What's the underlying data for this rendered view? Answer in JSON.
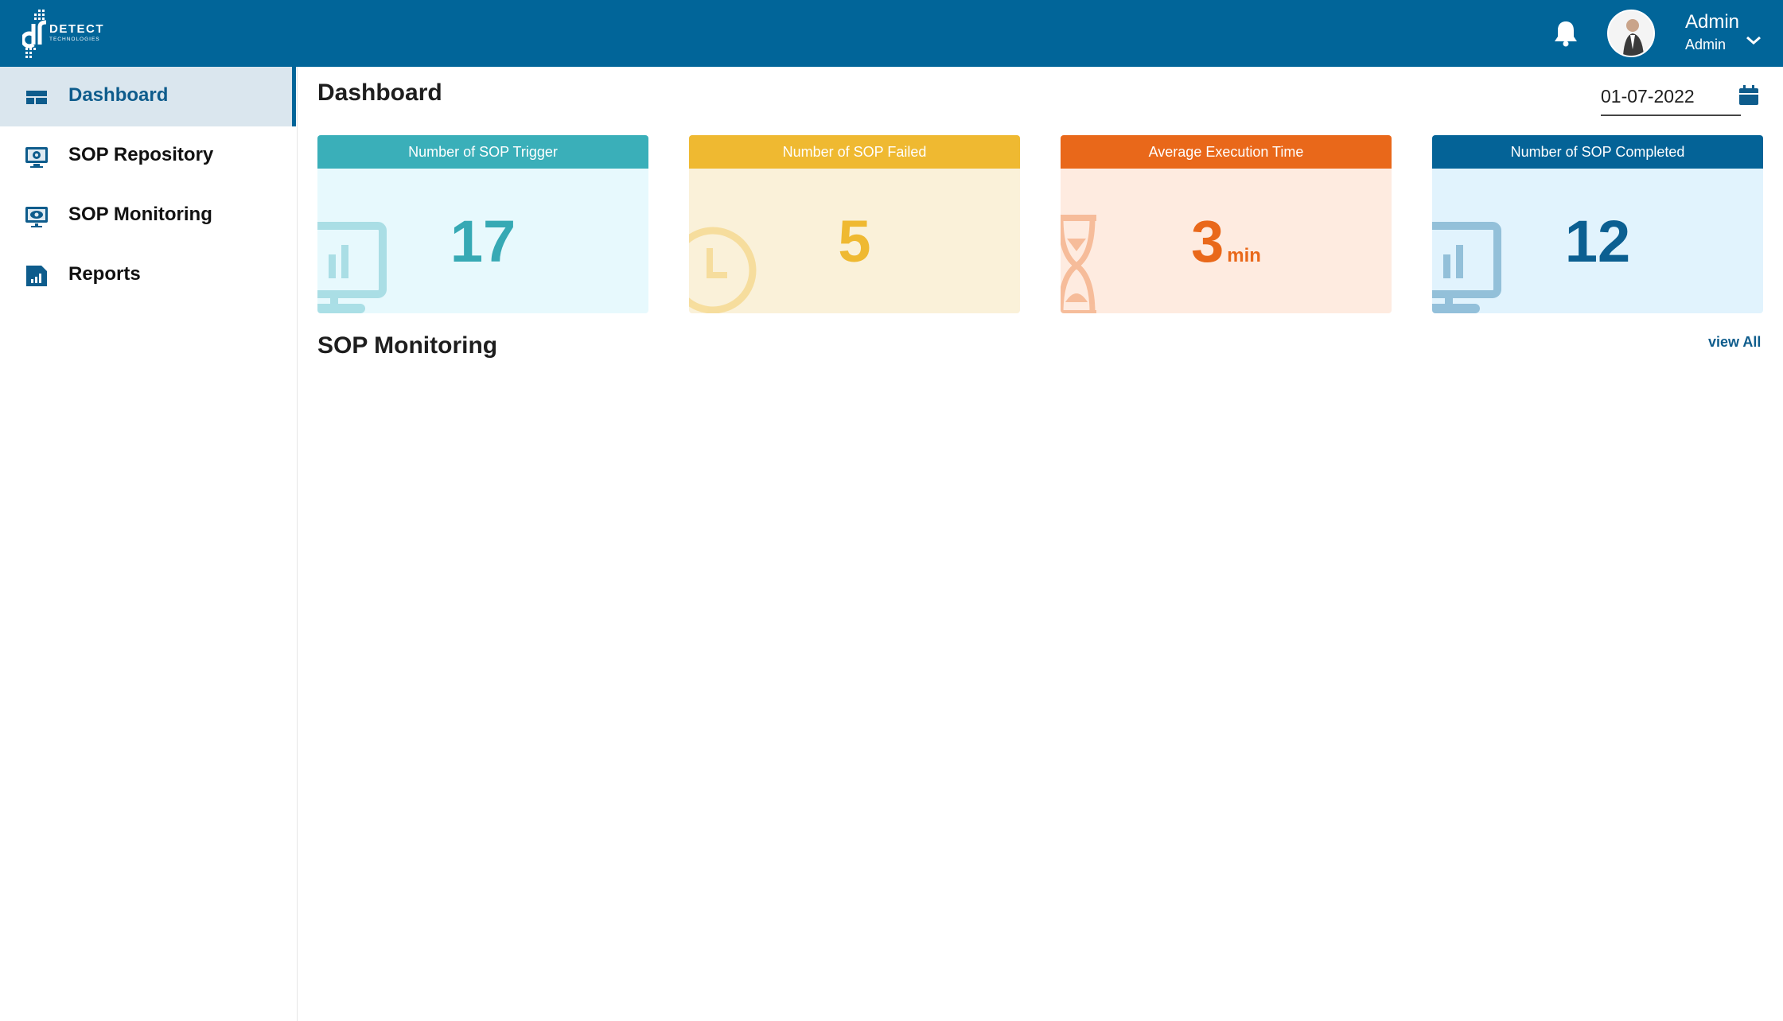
{
  "header": {
    "logo_brand": "DETECT",
    "logo_sub": "TECHNOLOGIES",
    "user_name": "Admin",
    "user_role": "Admin",
    "bar_color": "#016599"
  },
  "sidebar": {
    "items": [
      {
        "label": "Dashboard",
        "icon": "dashboard-icon",
        "active": true
      },
      {
        "label": "SOP Repository",
        "icon": "gear-monitor-icon",
        "active": false
      },
      {
        "label": "SOP Monitoring",
        "icon": "eye-monitor-icon",
        "active": false
      },
      {
        "label": "Reports",
        "icon": "bar-chart-icon",
        "active": false
      }
    ]
  },
  "main": {
    "title": "Dashboard",
    "date": "01-07-2022",
    "cards": [
      {
        "title": "Number of SOP Trigger",
        "value": "17",
        "unit": "",
        "color": "#3aafb9"
      },
      {
        "title": "Number of SOP Failed",
        "value": "5",
        "unit": "",
        "color": "#efb931"
      },
      {
        "title": "Average Execution Time",
        "value": "3",
        "unit": "min",
        "color": "#e9681a"
      },
      {
        "title": "Number of SOP Completed",
        "value": "12",
        "unit": "",
        "color": "#046397"
      }
    ],
    "section_title": "SOP Monitoring",
    "view_all": "view All"
  }
}
